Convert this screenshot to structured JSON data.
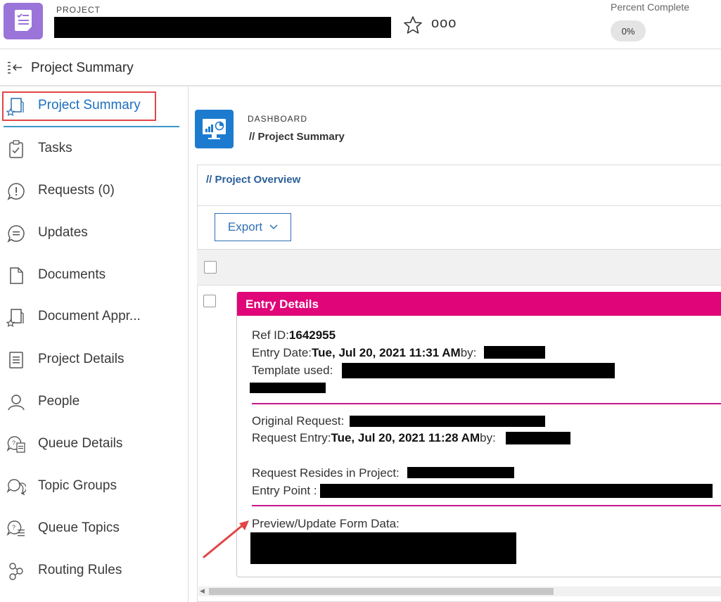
{
  "header": {
    "project_label": "PROJECT",
    "percent_label": "Percent Complete",
    "percent_value": "0%",
    "more_glyph": "ooo"
  },
  "breadcrumb": {
    "title": "Project Summary"
  },
  "sidebar": {
    "items": [
      {
        "label": "Project Summary",
        "icon": "doc-star-icon",
        "active": true
      },
      {
        "label": "Tasks",
        "icon": "clipboard-check-icon"
      },
      {
        "label": "Requests (0)",
        "icon": "alert-bubble-icon"
      },
      {
        "label": "Updates",
        "icon": "chat-bubble-icon"
      },
      {
        "label": "Documents",
        "icon": "document-icon"
      },
      {
        "label": "Document Appr...",
        "icon": "doc-star-icon"
      },
      {
        "label": "Project Details",
        "icon": "list-doc-icon"
      },
      {
        "label": "People",
        "icon": "person-icon"
      },
      {
        "label": "Queue Details",
        "icon": "queue-details-icon"
      },
      {
        "label": "Topic Groups",
        "icon": "topic-groups-icon"
      },
      {
        "label": "Queue Topics",
        "icon": "queue-topics-icon"
      },
      {
        "label": "Routing Rules",
        "icon": "routing-icon"
      }
    ]
  },
  "dashboard": {
    "label": "DASHBOARD",
    "title": "// Project Summary"
  },
  "overview": {
    "title": "// Project Overview",
    "export_label": "Export"
  },
  "entry": {
    "header": "Entry Details",
    "ref_label": "Ref ID:",
    "ref_value": "1642955",
    "entry_date_label": "Entry Date:",
    "entry_date_value": "Tue, Jul 20, 2021 11:31 AM",
    "by_label": "by:",
    "template_label": "Template used:",
    "original_request_label": "Original Request:",
    "request_entry_label": "Request Entry:",
    "request_entry_value": "Tue, Jul 20, 2021 11:28 AM",
    "resides_label": "Request Resides in Project:",
    "entry_point_label": "Entry Point :",
    "preview_label": "Preview/Update Form Data:"
  },
  "colors": {
    "accent_purple": "#9a74d9",
    "dashboard_blue": "#1d7bcf",
    "entry_header_pink": "#e0067a",
    "link_blue": "#2b5f99",
    "annotation_red": "#e14646"
  }
}
